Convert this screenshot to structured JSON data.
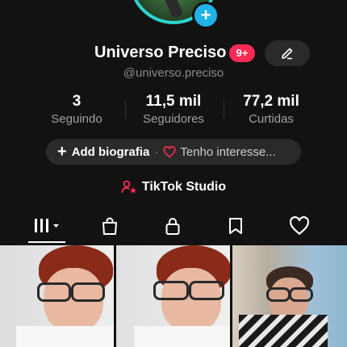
{
  "profile": {
    "display_name": "Universo Preciso",
    "notification_badge": "9+",
    "username": "@universo.preciso"
  },
  "stats": [
    {
      "value": "3",
      "label": "Seguindo"
    },
    {
      "value": "11,5 mil",
      "label": "Seguidores"
    },
    {
      "value": "77,2 mil",
      "label": "Curtidas"
    }
  ],
  "bio": {
    "add_label": "Add biografia",
    "separator": "·",
    "interest_label": "Tenho interesse..."
  },
  "studio": {
    "label": "TikTok Studio"
  },
  "tabs": [
    {
      "name": "videos",
      "icon": "grid-icon"
    },
    {
      "name": "shop",
      "icon": "shopping-bag-icon"
    },
    {
      "name": "private",
      "icon": "lock-icon"
    },
    {
      "name": "saved",
      "icon": "bookmark-icon"
    },
    {
      "name": "liked",
      "icon": "heart-icon"
    }
  ],
  "colors": {
    "background": "#121212",
    "accent_pink": "#fe2c55",
    "avatar_ring": "#2fd4cf",
    "plus_badge": "#1fb3e8"
  }
}
